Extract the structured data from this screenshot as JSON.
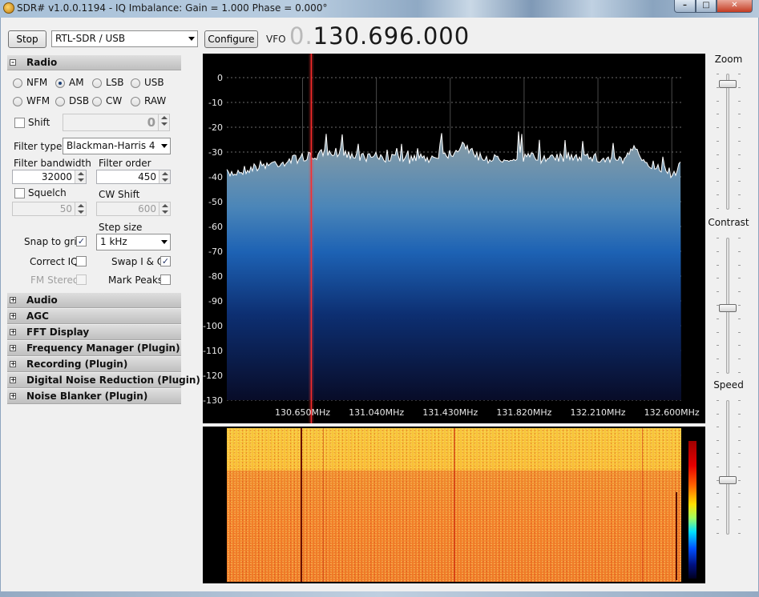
{
  "window": {
    "title": "SDR# v1.0.0.1194 - IQ Imbalance: Gain = 1.000 Phase = 0.000°"
  },
  "toolbar": {
    "stop_label": "Stop",
    "device": "RTL-SDR / USB",
    "configure_label": "Configure",
    "vfo_label": "VFO",
    "vfo_prefix": "0.",
    "vfo_value": "130.696.000"
  },
  "radio_panel": {
    "header": "Radio",
    "modes": [
      "NFM",
      "AM",
      "LSB",
      "USB",
      "WFM",
      "DSB",
      "CW",
      "RAW"
    ],
    "selected_mode": "AM",
    "shift_label": "Shift",
    "shift_value": "0",
    "filter_type_label": "Filter type",
    "filter_type_value": "Blackman-Harris 4",
    "filter_bandwidth_label": "Filter bandwidth",
    "filter_bandwidth_value": "32000",
    "filter_order_label": "Filter order",
    "filter_order_value": "450",
    "squelch_label": "Squelch",
    "squelch_value": "50",
    "cw_shift_label": "CW Shift",
    "cw_shift_value": "600",
    "step_size_label": "Step size",
    "step_size_value": "1 kHz",
    "snap_to_grid_label": "Snap to grid",
    "snap_to_grid_checked": true,
    "correct_iq_label": "Correct IQ",
    "swap_iq_label": "Swap I & Q",
    "swap_iq_checked": true,
    "fm_stereo_label": "FM Stereo",
    "mark_peaks_label": "Mark Peaks"
  },
  "plugin_sections": [
    "Audio",
    "AGC",
    "FFT Display",
    "Frequency Manager (Plugin)",
    "Recording (Plugin)",
    "Digital Noise Reduction (Plugin)",
    "Noise Blanker (Plugin)"
  ],
  "sliders": {
    "zoom_label": "Zoom",
    "contrast_label": "Contrast",
    "speed_label": "Speed",
    "zoom_level": 0.05,
    "contrast_level": 0.48,
    "speed_level": 0.4
  },
  "colors": {
    "vfo_marker": "#ff2a2a",
    "spectrum_fill_top": "#8a9aa0",
    "spectrum_fill_bottom": "#0a1030"
  },
  "chart_data": {
    "type": "area",
    "y_ticks": [
      0,
      -10,
      -20,
      -30,
      -40,
      -50,
      -60,
      -70,
      -80,
      -90,
      -100,
      -110,
      -120,
      -130
    ],
    "x_tick_labels": [
      "130.650MHz",
      "131.040MHz",
      "131.430MHz",
      "131.820MHz",
      "132.210MHz",
      "132.600MHz"
    ],
    "x_ticks_mhz": [
      130.65,
      131.04,
      131.43,
      131.82,
      132.21,
      132.6
    ],
    "xlim": [
      130.25,
      132.65
    ],
    "ylim": [
      -130,
      0
    ],
    "vfo_mhz": 130.696,
    "grid": true,
    "series": [
      {
        "x": [
          130.25,
          130.35,
          130.45,
          130.55,
          130.6,
          130.65,
          130.7,
          130.75,
          130.85,
          130.95,
          131.05,
          131.15,
          131.25,
          131.35,
          131.45,
          131.5,
          131.55,
          131.65,
          131.75,
          131.85,
          131.95,
          132.05,
          132.15,
          132.25,
          132.35,
          132.4,
          132.45,
          132.55,
          132.65
        ],
        "values": [
          -37,
          -35,
          -33,
          -32,
          -31,
          -30,
          -30,
          -29,
          -28,
          -30,
          -30,
          -31,
          -31,
          -30,
          -28,
          -24,
          -29,
          -31,
          -30,
          -30,
          -31,
          -30,
          -30,
          -31,
          -31,
          -27,
          -31,
          -35,
          -38
        ]
      }
    ]
  }
}
